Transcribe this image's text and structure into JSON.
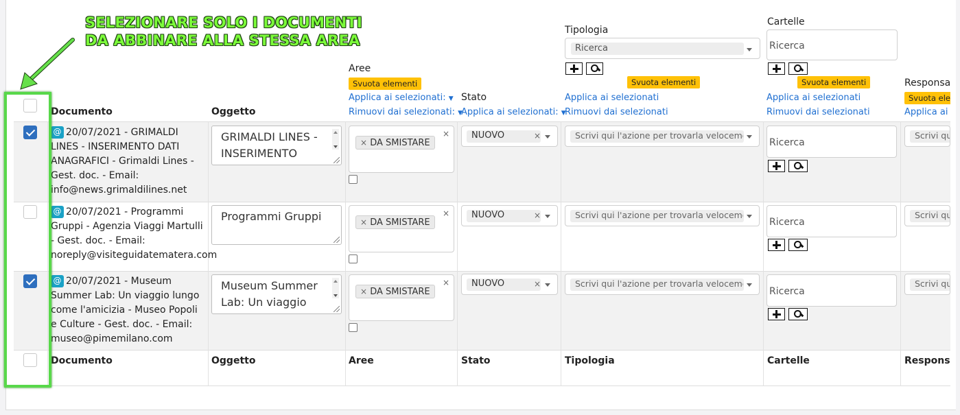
{
  "annotation": {
    "line1": "SELEZIONARE SOLO I DOCUMENTI",
    "line2": "DA ABBINARE ALLA STESSA AREA",
    "color": "#7cfc3a"
  },
  "header": {
    "documento": "Documento",
    "oggetto": "Oggetto",
    "aree": {
      "label": "Aree",
      "svuota": "Svuota elementi",
      "applica": "Applica ai selezionati:",
      "rimuovi": "Rimuovi dai selezionati:"
    },
    "stato": {
      "label": "Stato",
      "applica": "Applica ai selezionati:"
    },
    "tipologia": {
      "label": "Tipologia",
      "search_value": "Ricerca",
      "svuota": "Svuota elementi",
      "applica": "Applica ai selezionati",
      "rimuovi": "Rimuovi dai selezionati"
    },
    "cartelle": {
      "label": "Cartelle",
      "search_placeholder": "Ricerca",
      "svuota": "Svuota elementi",
      "applica": "Applica ai selezionati",
      "rimuovi": "Rimuovi dai selezionati"
    },
    "responsabile": {
      "label": "Responsabile",
      "svuota": "Svuota elementi",
      "applica": "Applica ai selezionati"
    }
  },
  "rows": [
    {
      "checked": true,
      "doc_prefix": "20/07/2021 - GRIMALDI LINES - INSERIMENTO DATI ANAGRAFICI - Grimaldi Lines - Gest. doc. - Email: info@news.grimaldilines.net",
      "oggetto": "GRIMALDI LINES - INSERIMENTO",
      "area_tag": "DA SMISTARE",
      "stato": "NUOVO",
      "tipologia_placeholder": "Scrivi qui l'azione per trovarla velocemente",
      "cartelle_placeholder": "Ricerca",
      "resp_placeholder": "Scrivi qui"
    },
    {
      "checked": false,
      "doc_prefix": "20/07/2021 - Programmi Gruppi - Agenzia Viaggi Martulli - Gest. doc. - Email: noreply@visiteguidatematera.com",
      "oggetto": "Programmi Gruppi",
      "area_tag": "DA SMISTARE",
      "stato": "NUOVO",
      "tipologia_placeholder": "Scrivi qui l'azione per trovarla velocemente",
      "cartelle_placeholder": "Ricerca",
      "resp_placeholder": "Scrivi qui"
    },
    {
      "checked": true,
      "doc_prefix": "20/07/2021 - Museum Summer Lab: Un viaggio lungo come l'amicizia - Museo Popoli e Culture - Gest. doc. - Email: museo@pimemilano.com",
      "oggetto": "Museum Summer Lab: Un viaggio",
      "area_tag": "DA SMISTARE",
      "stato": "NUOVO",
      "tipologia_placeholder": "Scrivi qui l'azione per trovarla velocemente",
      "cartelle_placeholder": "Ricerca",
      "resp_placeholder": "Scrivi qui"
    }
  ],
  "footer": {
    "documento": "Documento",
    "oggetto": "Oggetto",
    "aree": "Aree",
    "stato": "Stato",
    "tipologia": "Tipologia",
    "cartelle": "Cartelle",
    "responsabile": "Responsabile"
  },
  "icons": {
    "email": "@",
    "remove": "×"
  }
}
